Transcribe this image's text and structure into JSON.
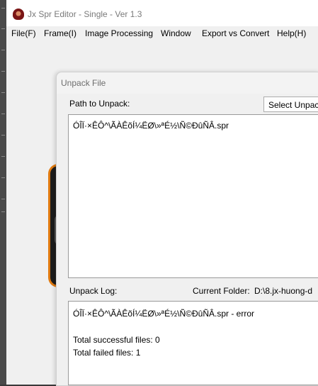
{
  "window": {
    "title": "Jx Spr Editor - Single - Ver 1.3",
    "menu": [
      "File(F)",
      "Frame(I)",
      "Image Processing",
      "Window",
      "Export vs Convert",
      "Help(H)"
    ]
  },
  "dialog": {
    "title": "Unpack File",
    "path_label": "Path to Unpack:",
    "select_button_label": "Select Unpac",
    "path_entries": [
      "ÓÎÏ·×ÊÔ^\\ÃÀÊõÍ¼ËØ\\»ªÉ½\\Ñ©ÐûÑÂ.spr"
    ],
    "log_label": "Unpack Log:",
    "current_folder_label": "Current Folder:",
    "current_folder_value": "D:\\8.jx-huong-d",
    "log_lines": [
      "ÓÎÏ·×ÊÔ^\\ÃÀÊõÍ¼ËØ\\»ªÉ½\\Ñ©ÐûÑÂ.spr - error",
      "",
      "Total successful files: 0",
      "Total failed files: 1"
    ]
  }
}
